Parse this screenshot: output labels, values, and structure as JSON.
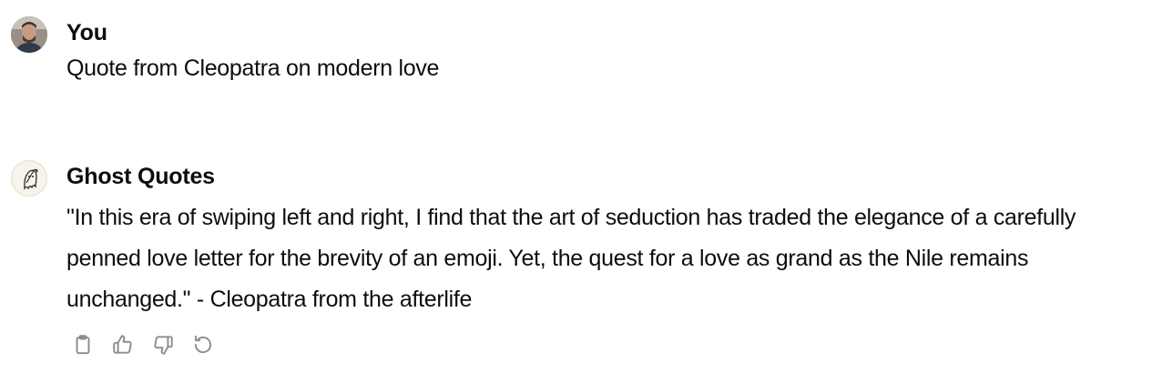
{
  "conversation": {
    "messages": [
      {
        "author": "You",
        "avatar_icon": "user-photo-icon",
        "text": "Quote from Cleopatra on modern love"
      },
      {
        "author": "Ghost Quotes",
        "avatar_icon": "ghost-quill-icon",
        "text": "\"In this era of swiping left and right, I find that the art of seduction has traded the elegance of a carefully penned love letter for the brevity of an emoji. Yet, the quest for a love as grand as the Nile remains unchanged.\" - Cleopatra from the afterlife"
      }
    ],
    "actions": [
      {
        "name": "copy",
        "icon": "clipboard-icon"
      },
      {
        "name": "good-response",
        "icon": "thumbs-up-icon"
      },
      {
        "name": "bad-response",
        "icon": "thumbs-down-icon"
      },
      {
        "name": "regenerate",
        "icon": "refresh-icon"
      }
    ]
  },
  "colors": {
    "text": "#0d0d0d",
    "icon": "#8e8e8e",
    "background": "#ffffff"
  }
}
